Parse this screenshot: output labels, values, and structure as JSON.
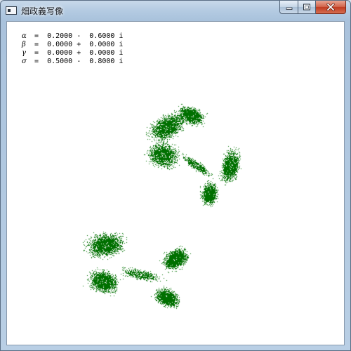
{
  "window": {
    "title": "畑政義写像",
    "buttons": {
      "minimize": "minimize",
      "maximize": "maximize",
      "close": "close"
    }
  },
  "parameters": [
    {
      "symbol": "α",
      "text": " =  0.2000 -  0.6000 i"
    },
    {
      "symbol": "β",
      "text": " =  0.0000 +  0.0000 i"
    },
    {
      "symbol": "γ",
      "text": " =  0.0000 +  0.0000 i"
    },
    {
      "symbol": "σ",
      "text": " =  0.5000 -  0.8000 i"
    }
  ],
  "colors": {
    "fractal": "#007000",
    "canvas": "#ffffff"
  },
  "icons": {
    "app": "app-window-icon",
    "minimize": "minimize-icon",
    "maximize": "maximize-icon",
    "close": "close-icon"
  }
}
